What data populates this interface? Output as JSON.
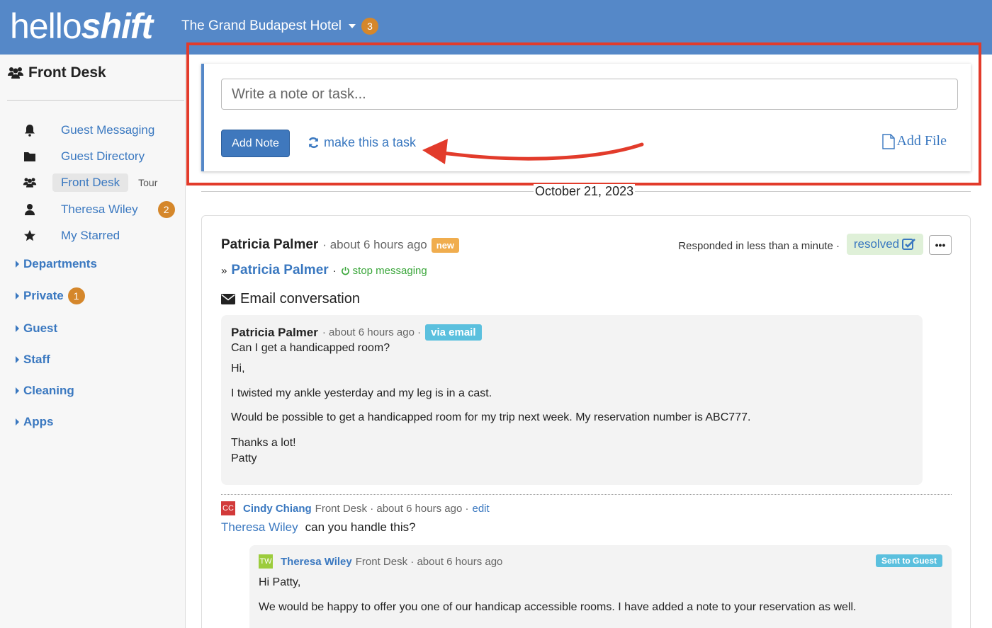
{
  "app": {
    "logo_part1": "hello",
    "logo_part2": "shift",
    "hotel_name": "The Grand Budapest Hotel",
    "hotel_badge": "3"
  },
  "sidebar": {
    "title": "Front Desk",
    "items": [
      {
        "label": "Guest Messaging",
        "icon": "bell-icon"
      },
      {
        "label": "Guest Directory",
        "icon": "folder-icon"
      },
      {
        "label": "Front Desk",
        "icon": "users-icon",
        "extra": "Tour"
      },
      {
        "label": "Theresa Wiley",
        "icon": "user-icon",
        "badge": "2"
      },
      {
        "label": "My Starred",
        "icon": "star-icon"
      }
    ],
    "groups": [
      {
        "label": "Departments"
      },
      {
        "label": "Private",
        "badge": "1"
      },
      {
        "label": "Guest"
      },
      {
        "label": "Staff"
      },
      {
        "label": "Cleaning"
      },
      {
        "label": "Apps"
      }
    ]
  },
  "composer": {
    "placeholder": "Write a note or task...",
    "add_note_label": "Add Note",
    "make_task_label": "make this a task",
    "add_file_label": "Add File"
  },
  "feed": {
    "date": "October 21, 2023"
  },
  "thread": {
    "author": "Patricia Palmer",
    "time": "about 6 hours ago",
    "new_badge": "new",
    "responded": "Responded in less than a minute",
    "resolved_label": "resolved",
    "contact_prefix": "»",
    "contact_name": "Patricia Palmer",
    "stop_label": "stop messaging",
    "email_title": "Email conversation",
    "message": {
      "author": "Patricia Palmer",
      "time": "about 6 hours ago",
      "via": "via email",
      "subject": "Can I get a handicapped room?",
      "lines": [
        "Hi,",
        "I twisted my ankle yesterday and my leg is in a cast.",
        "Would be possible to get a handicapped room for my trip next week. My reservation number is ABC777.",
        "Thanks a lot!",
        "Patty"
      ]
    },
    "comment": {
      "initials": "CC",
      "author": "Cindy Chiang",
      "dept": "Front Desk",
      "time": "about 6 hours ago",
      "edit": "edit",
      "mention": "Theresa Wiley",
      "text": "can you handle this?"
    },
    "reply": {
      "initials": "TW",
      "author": "Theresa Wiley",
      "dept": "Front Desk",
      "time": "about 6 hours ago",
      "sent_label": "Sent to Guest",
      "lines": [
        "Hi Patty,",
        "We would be happy to offer you one of our handicap accessible rooms. I have added a note to your reservation as well."
      ]
    }
  },
  "colors": {
    "topbar": "#5588c8",
    "link": "#3a78c0",
    "highlight": "#e23b2b",
    "badge_orange": "#d5872b"
  }
}
